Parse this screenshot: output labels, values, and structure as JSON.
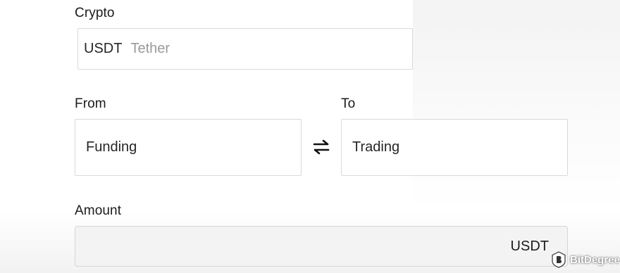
{
  "crypto": {
    "label": "Crypto",
    "symbol": "USDT",
    "name": "Tether"
  },
  "from": {
    "label": "From",
    "value": "Funding"
  },
  "to": {
    "label": "To",
    "value": "Trading"
  },
  "swap": {
    "icon": "swap-arrows-icon"
  },
  "amount": {
    "label": "Amount",
    "value": "",
    "unit": "USDT"
  },
  "watermark": {
    "text": "BitDegree",
    "icon": "bitdegree-logo-icon"
  }
}
